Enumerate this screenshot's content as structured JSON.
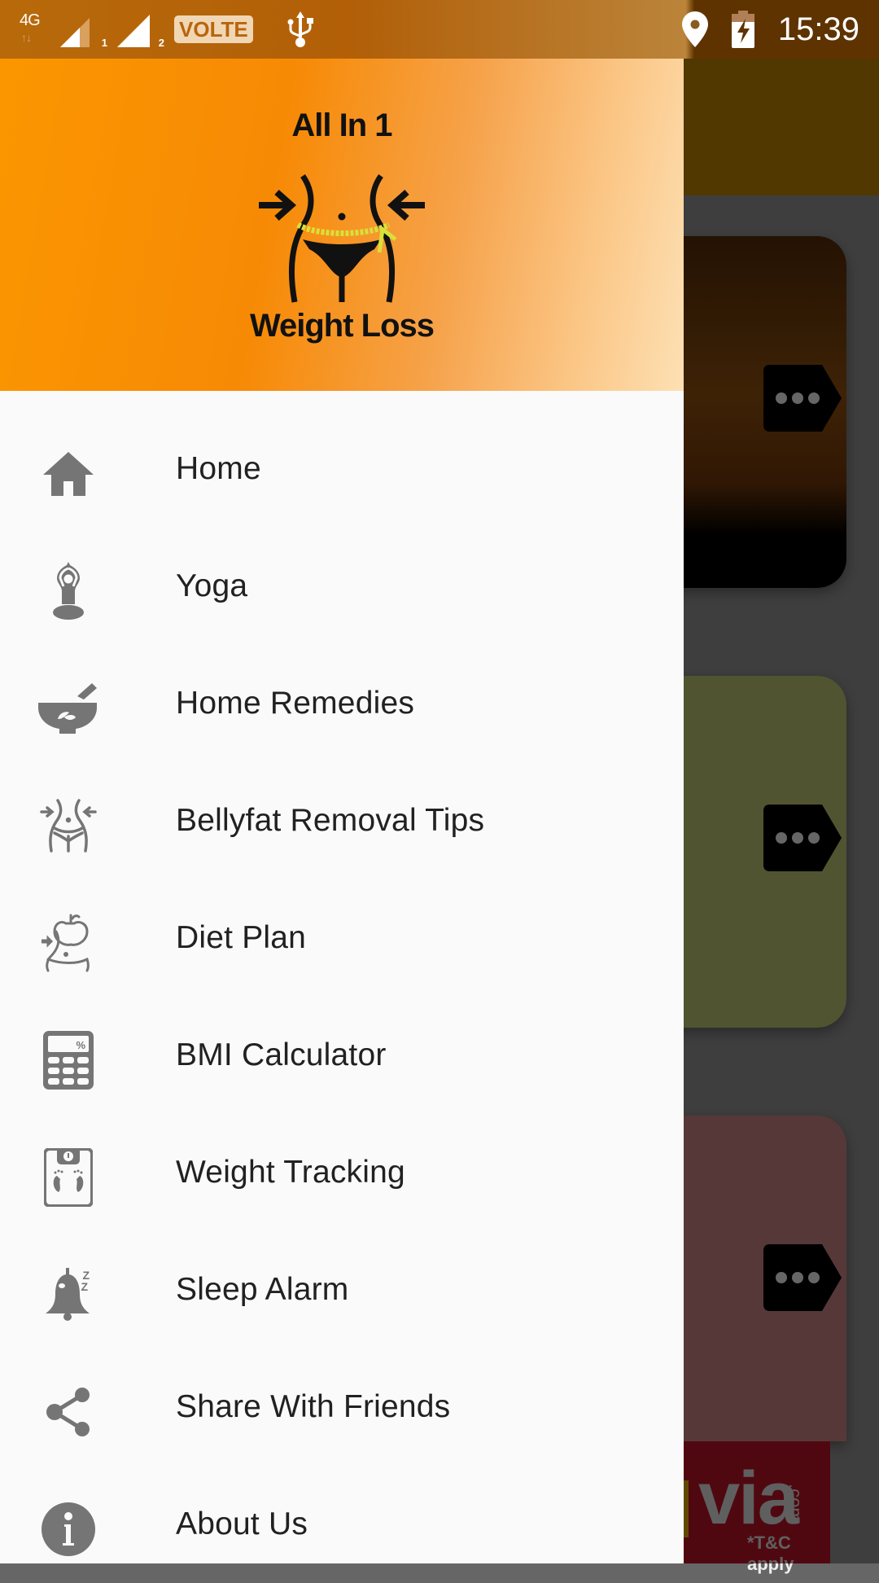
{
  "status_bar": {
    "network_type": "4G",
    "sim1_label": "1",
    "sim2_label": "2",
    "volte_label": "VOLTE",
    "time": "15:39"
  },
  "drawer": {
    "logo": {
      "line1": "All In 1",
      "line2": "Weight Loss"
    },
    "items": [
      {
        "label": "Home",
        "icon": "home-icon"
      },
      {
        "label": "Yoga",
        "icon": "yoga-icon"
      },
      {
        "label": "Home Remedies",
        "icon": "mortar-pestle-icon"
      },
      {
        "label": "Bellyfat Removal Tips",
        "icon": "waist-icon"
      },
      {
        "label": "Diet Plan",
        "icon": "diet-apple-icon"
      },
      {
        "label": "BMI Calculator",
        "icon": "calculator-icon"
      },
      {
        "label": "Weight Tracking",
        "icon": "weighing-scale-icon"
      },
      {
        "label": "Sleep Alarm",
        "icon": "sleep-bell-icon"
      },
      {
        "label": "Share With Friends",
        "icon": "share-icon"
      },
      {
        "label": "About Us",
        "icon": "info-icon"
      }
    ]
  },
  "background": {
    "ad": {
      "brand": "via",
      "domain": ".com",
      "disclaimer": "*T&C apply"
    }
  },
  "colors": {
    "accent": "#fb9600",
    "icon_gray": "#757575",
    "text": "#212121"
  }
}
